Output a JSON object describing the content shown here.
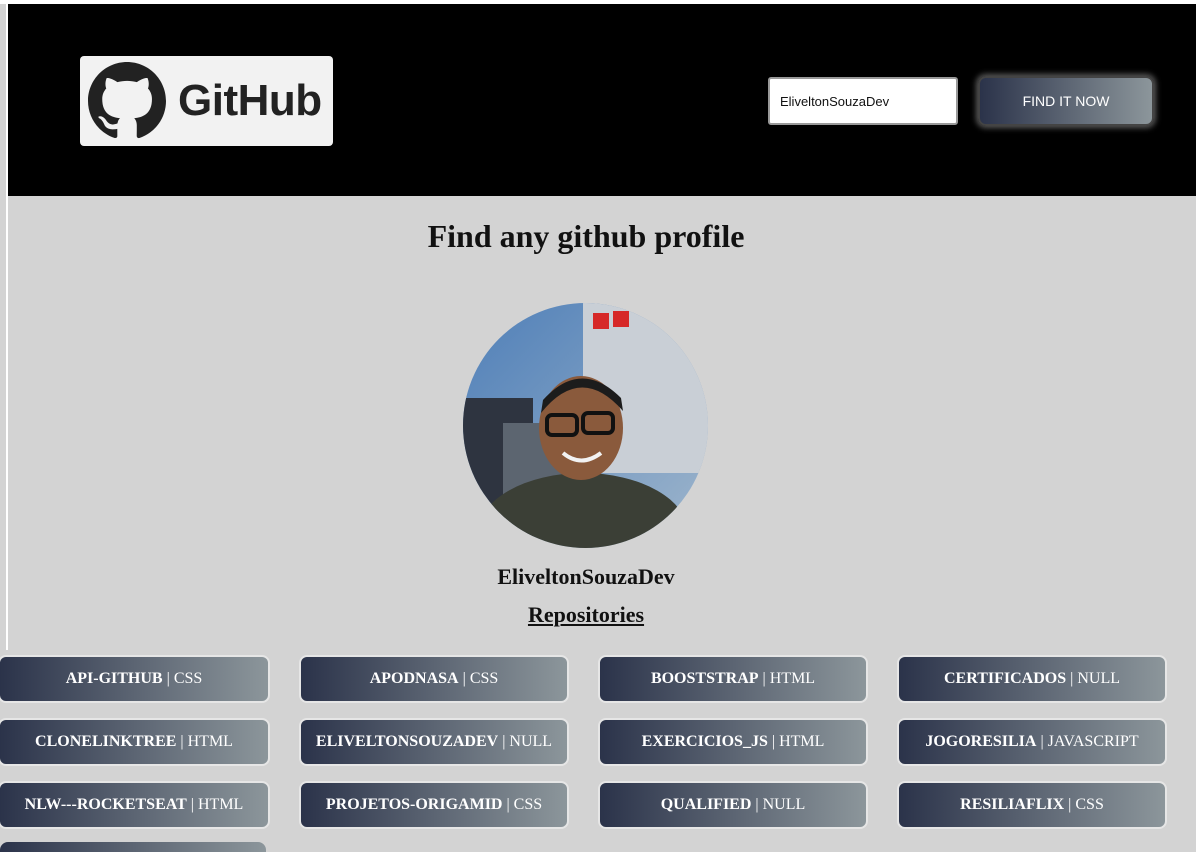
{
  "header": {
    "logo_text": "GitHub",
    "search": {
      "value": "EliveltonSouzaDev",
      "placeholder": ""
    },
    "button_label": "FIND IT NOW"
  },
  "main": {
    "title": "Find any github profile",
    "username": "EliveltonSouzaDev",
    "repos_heading": "Repositories"
  },
  "repositories": [
    {
      "name": "API-GITHUB",
      "language": "CSS"
    },
    {
      "name": "APODNASA",
      "language": "CSS"
    },
    {
      "name": "BOOSTSTRAP",
      "language": "HTML"
    },
    {
      "name": "CERTIFICADOS",
      "language": "NULL"
    },
    {
      "name": "CLONELINKTREE",
      "language": "HTML"
    },
    {
      "name": "ELIVELTONSOUZADEV",
      "language": "NULL"
    },
    {
      "name": "EXERCICIOS_JS",
      "language": "HTML"
    },
    {
      "name": "JOGORESILIA",
      "language": "JAVASCRIPT"
    },
    {
      "name": "NLW---ROCKETSEAT",
      "language": "HTML"
    },
    {
      "name": "PROJETOS-ORIGAMID",
      "language": "CSS"
    },
    {
      "name": "QUALIFIED",
      "language": "NULL"
    },
    {
      "name": "RESILIAFLIX",
      "language": "CSS"
    }
  ],
  "colors": {
    "header_bg": "#000000",
    "page_bg": "#d3d3d3",
    "button_gradient_start": "#2b334a",
    "button_gradient_end": "#8c969b"
  },
  "icons": {
    "logo": "github-octocat-icon"
  }
}
